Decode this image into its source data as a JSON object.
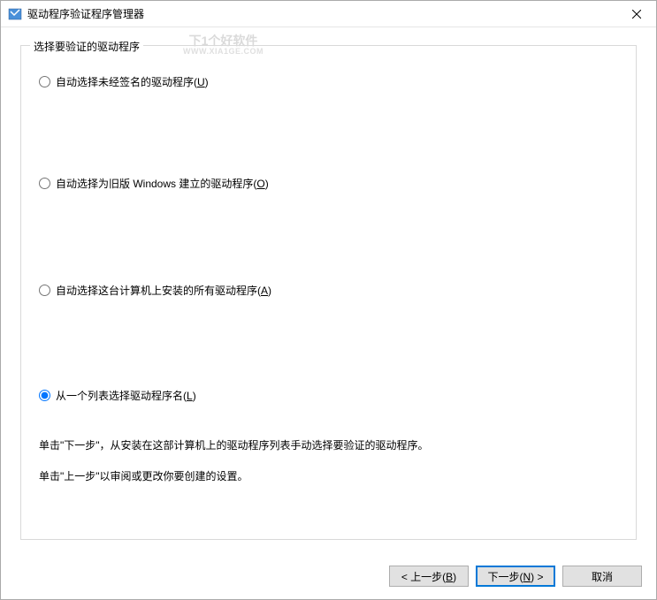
{
  "window": {
    "title": "驱动程序验证程序管理器"
  },
  "fieldset": {
    "legend": "选择要验证的驱动程序"
  },
  "radios": {
    "opt1": {
      "label": "自动选择未经签名的驱动程序(",
      "accel": "U",
      "suffix": ")"
    },
    "opt2": {
      "label": "自动选择为旧版 Windows 建立的驱动程序(",
      "accel": "O",
      "suffix": ")"
    },
    "opt3": {
      "label": "自动选择这台计算机上安装的所有驱动程序(",
      "accel": "A",
      "suffix": ")"
    },
    "opt4": {
      "label": "从一个列表选择驱动程序名(",
      "accel": "L",
      "suffix": ")"
    }
  },
  "info": {
    "line1": "单击\"下一步\"，从安装在这部计算机上的驱动程序列表手动选择要验证的驱动程序。",
    "line2": "单击\"上一步\"以审阅或更改你要创建的设置。"
  },
  "buttons": {
    "back": {
      "prefix": "< 上一步(",
      "accel": "B",
      "suffix": ")"
    },
    "next": {
      "prefix": "下一步(",
      "accel": "N",
      "suffix": ") >"
    },
    "cancel": "取消"
  },
  "watermark": {
    "main": "下1个好软件",
    "sub": "WWW.XIA1GE.COM"
  }
}
